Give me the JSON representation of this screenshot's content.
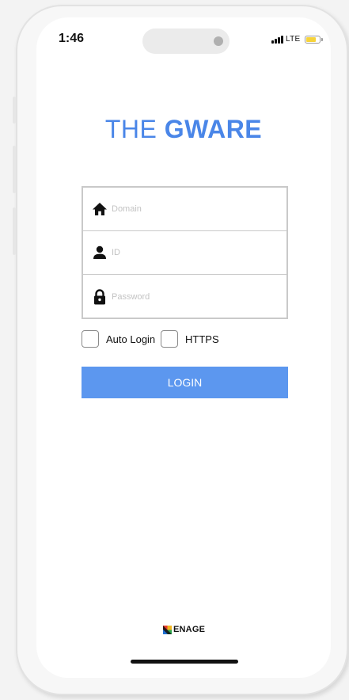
{
  "status_bar": {
    "time": "1:46",
    "network": "LTE",
    "battery_level": 0.75,
    "battery_color": "#f6d33b"
  },
  "header": {
    "title_prefix": "THE",
    "title_bold": "GWARE",
    "title_color": "#4a86e8"
  },
  "form": {
    "domain": {
      "placeholder": "Domain",
      "value": "",
      "icon": "home-icon"
    },
    "id": {
      "placeholder": "ID",
      "value": "",
      "icon": "user-icon"
    },
    "password": {
      "placeholder": "Password",
      "value": "",
      "icon": "lock-icon"
    }
  },
  "options": {
    "auto_login": {
      "label": "Auto Login",
      "checked": false
    },
    "https": {
      "label": "HTTPS",
      "checked": false
    }
  },
  "login_button": {
    "label": "LOGIN",
    "color": "#5c97ef"
  },
  "footer": {
    "brand_name": "ENAGE"
  }
}
